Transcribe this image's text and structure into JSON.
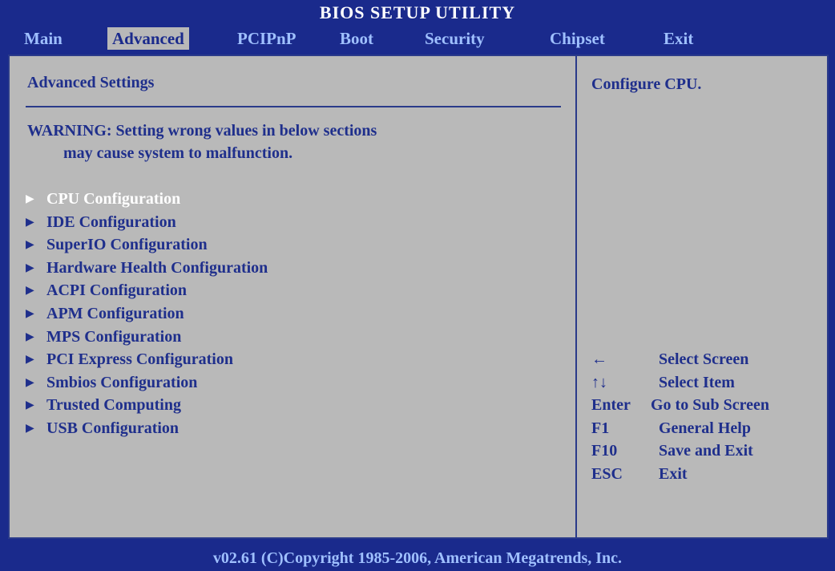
{
  "title": "BIOS SETUP UTILITY",
  "menu": {
    "main": "Main",
    "advanced": "Advanced",
    "pcipnp": "PCIPnP",
    "boot": "Boot",
    "security": "Security",
    "chipset": "Chipset",
    "exit": "Exit"
  },
  "section": {
    "title": "Advanced Settings",
    "warning_line1": "WARNING: Setting wrong values in below sections",
    "warning_line2": "         may cause system to malfunction."
  },
  "items": [
    {
      "label": "CPU Configuration"
    },
    {
      "label": "IDE Configuration"
    },
    {
      "label": "SuperIO Configuration"
    },
    {
      "label": "Hardware Health Configuration"
    },
    {
      "label": "ACPI Configuration"
    },
    {
      "label": "APM Configuration"
    },
    {
      "label": "MPS Configuration"
    },
    {
      "label": "PCI Express Configuration"
    },
    {
      "label": "Smbios Configuration"
    },
    {
      "label": "Trusted Computing"
    },
    {
      "label": "USB Configuration"
    }
  ],
  "help": {
    "text": "Configure CPU."
  },
  "keys": [
    {
      "key": "←",
      "desc": "  Select Screen"
    },
    {
      "key": "↑↓",
      "desc": "  Select Item"
    },
    {
      "key": "Enter",
      "desc": "Go to Sub Screen"
    },
    {
      "key": "F1",
      "desc": "  General Help"
    },
    {
      "key": "F10",
      "desc": "  Save and Exit"
    },
    {
      "key": "ESC",
      "desc": "  Exit"
    }
  ],
  "footer": "v02.61 (C)Copyright 1985-2006, American Megatrends, Inc.",
  "colors": {
    "background": "#1a2a8c",
    "panel": "#b9b9b9",
    "text": "#1f2f8c",
    "highlight": "#ffffff",
    "menu_text": "#9fc0ff"
  }
}
